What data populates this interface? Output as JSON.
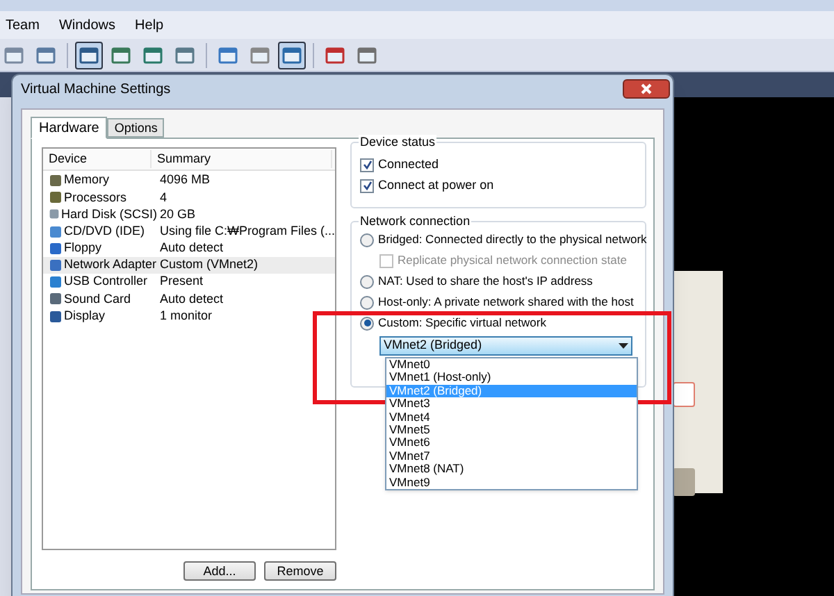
{
  "menu": [
    "Team",
    "Windows",
    "Help"
  ],
  "toolbar": [
    {
      "selected": false
    },
    {
      "selected": false
    },
    {
      "selected": true
    },
    {
      "selected": false
    },
    {
      "selected": false
    },
    {
      "selected": false
    },
    {
      "selected": false
    },
    {
      "selected": false
    },
    {
      "selected": true
    },
    {
      "selected": false
    },
    {
      "selected": false
    }
  ],
  "dialog": {
    "title": "Virtual Machine Settings",
    "tabs": [
      {
        "label": "Hardware",
        "selected": true
      },
      {
        "label": "Options",
        "selected": false
      }
    ],
    "device_list": {
      "columns": [
        "Device",
        "Summary"
      ],
      "rows": [
        {
          "device": "Memory",
          "summary": "4096 MB",
          "selected": false
        },
        {
          "device": "Processors",
          "summary": "4",
          "selected": false
        },
        {
          "device": "Hard Disk (SCSI)",
          "summary": "20 GB",
          "selected": false
        },
        {
          "device": "CD/DVD (IDE)",
          "summary": "Using file C:₩Program Files (...",
          "selected": false
        },
        {
          "device": "Floppy",
          "summary": "Auto detect",
          "selected": false
        },
        {
          "device": "Network Adapter",
          "summary": "Custom (VMnet2)",
          "selected": true
        },
        {
          "device": "USB Controller",
          "summary": "Present",
          "selected": false
        },
        {
          "device": "Sound Card",
          "summary": "Auto detect",
          "selected": false
        },
        {
          "device": "Display",
          "summary": "1 monitor",
          "selected": false
        }
      ]
    },
    "buttons": [
      "Add...",
      "Remove"
    ],
    "device_status": {
      "title": "Device status",
      "options": [
        {
          "label": "Connected",
          "checked": true
        },
        {
          "label": "Connect at power on",
          "checked": true
        }
      ]
    },
    "network_connection": {
      "title": "Network connection",
      "options": [
        {
          "kind": "radio",
          "label": "Bridged: Connected directly to the physical network",
          "selected": false
        },
        {
          "kind": "checkbox",
          "label": "Replicate physical network connection state",
          "checked": false,
          "disabled": true
        },
        {
          "kind": "radio",
          "label": "NAT: Used to share the host's IP address",
          "selected": false
        },
        {
          "kind": "radio",
          "label": "Host-only: A private network shared with the host",
          "selected": false
        },
        {
          "kind": "radio",
          "label": "Custom: Specific virtual network",
          "selected": true
        }
      ],
      "dropdown": {
        "value": "VMnet2 (Bridged)",
        "expanded": true,
        "options": [
          {
            "label": "VMnet0",
            "selected": false
          },
          {
            "label": "VMnet1 (Host-only)",
            "selected": false
          },
          {
            "label": "VMnet2 (Bridged)",
            "selected": true
          },
          {
            "label": "VMnet3",
            "selected": false
          },
          {
            "label": "VMnet4",
            "selected": false
          },
          {
            "label": "VMnet5",
            "selected": false
          },
          {
            "label": "VMnet6",
            "selected": false
          },
          {
            "label": "VMnet7",
            "selected": false
          },
          {
            "label": "VMnet8 (NAT)",
            "selected": false
          },
          {
            "label": "VMnet9",
            "selected": false
          }
        ]
      }
    }
  }
}
